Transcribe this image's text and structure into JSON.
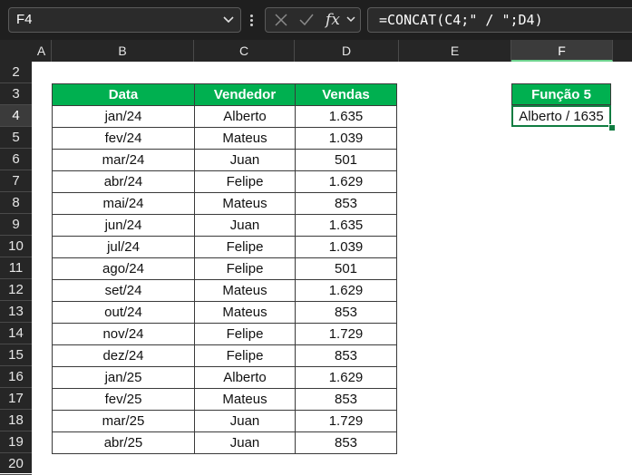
{
  "formula_bar": {
    "name_box": "F4",
    "formula": "=CONCAT(C4;\" / \";D4)",
    "fx_label": "fx"
  },
  "columns": [
    "A",
    "B",
    "C",
    "D",
    "E",
    "F"
  ],
  "selected_column": "F",
  "rows": [
    "2",
    "3",
    "4",
    "5",
    "6",
    "7",
    "8",
    "9",
    "10",
    "11",
    "12",
    "13",
    "14",
    "15",
    "16",
    "17",
    "18",
    "19",
    "20"
  ],
  "selected_row": "4",
  "table": {
    "headers": [
      "Data",
      "Vendedor",
      "Vendas"
    ],
    "rows": [
      [
        "jan/24",
        "Alberto",
        "1.635"
      ],
      [
        "fev/24",
        "Mateus",
        "1.039"
      ],
      [
        "mar/24",
        "Juan",
        "501"
      ],
      [
        "abr/24",
        "Felipe",
        "1.629"
      ],
      [
        "mai/24",
        "Mateus",
        "853"
      ],
      [
        "jun/24",
        "Juan",
        "1.635"
      ],
      [
        "jul/24",
        "Felipe",
        "1.039"
      ],
      [
        "ago/24",
        "Felipe",
        "501"
      ],
      [
        "set/24",
        "Mateus",
        "1.629"
      ],
      [
        "out/24",
        "Mateus",
        "853"
      ],
      [
        "nov/24",
        "Felipe",
        "1.729"
      ],
      [
        "dez/24",
        "Felipe",
        "853"
      ],
      [
        "jan/25",
        "Alberto",
        "1.629"
      ],
      [
        "fev/25",
        "Mateus",
        "853"
      ],
      [
        "mar/25",
        "Juan",
        "1.729"
      ],
      [
        "abr/25",
        "Juan",
        "853"
      ]
    ]
  },
  "result": {
    "header": "Função 5",
    "value": "Alberto / 1635"
  },
  "colors": {
    "header_green": "#00b050",
    "selection_green": "#107c41"
  }
}
